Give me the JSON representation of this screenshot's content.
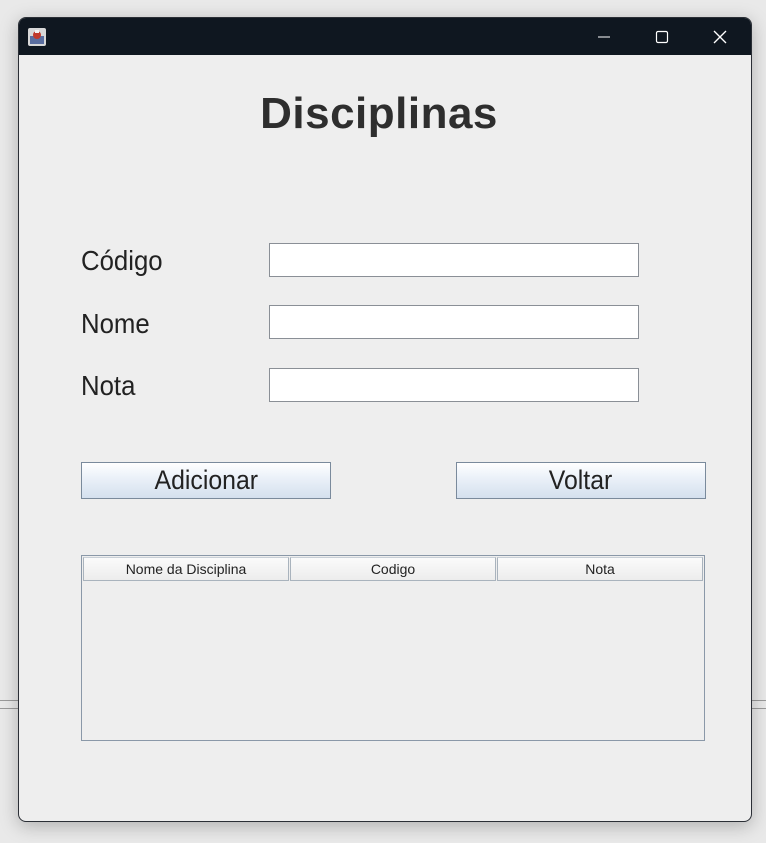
{
  "window": {
    "icon": "java-app-icon",
    "controls": [
      "minimize-icon",
      "maximize-icon",
      "close-icon"
    ]
  },
  "form": {
    "title": "Disciplinas",
    "fields": [
      {
        "label": "Código",
        "value": ""
      },
      {
        "label": "Nome",
        "value": ""
      },
      {
        "label": "Nota",
        "value": ""
      }
    ],
    "add_label": "Adicionar",
    "back_label": "Voltar"
  },
  "table": {
    "columns": [
      "Nome da Disciplina",
      "Codigo",
      "Nota"
    ],
    "rows": []
  },
  "colors": {
    "titlebar": "#0f1720",
    "window_bg": "#eeeeee",
    "button_gradient_bottom": "#d4e0ee"
  }
}
